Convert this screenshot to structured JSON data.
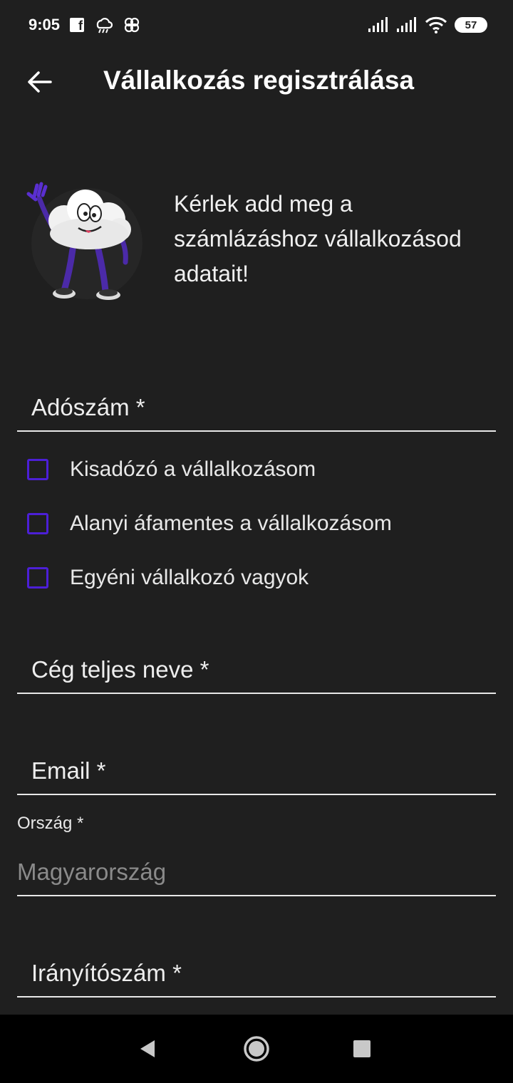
{
  "status_bar": {
    "time": "9:05",
    "battery": "57"
  },
  "app_bar": {
    "title": "Vállalkozás regisztrálása"
  },
  "intro": {
    "text": "Kérlek add meg a számlázáshoz vállalkozásod adatait!"
  },
  "form": {
    "tax_number_placeholder": "Adószám *",
    "checkboxes": [
      {
        "label": "Kisadózó a vállalkozásom",
        "checked": false
      },
      {
        "label": "Alanyi áfamentes a vállalkozásom",
        "checked": false
      },
      {
        "label": "Egyéni vállalkozó vagyok",
        "checked": false
      }
    ],
    "company_name_placeholder": "Cég teljes neve *",
    "email_placeholder": "Email *",
    "country_label": "Ország *",
    "country_value": "Magyarország",
    "zip_placeholder": "Irányítószám *"
  },
  "colors": {
    "background": "#1f1f1f",
    "checkbox_accent": "#4c1fd6",
    "nav_bar": "#000000"
  },
  "icons": {
    "back": "arrow-left-icon",
    "nav_back": "triangle-back-icon",
    "nav_home": "circle-home-icon",
    "nav_recents": "square-recents-icon"
  }
}
